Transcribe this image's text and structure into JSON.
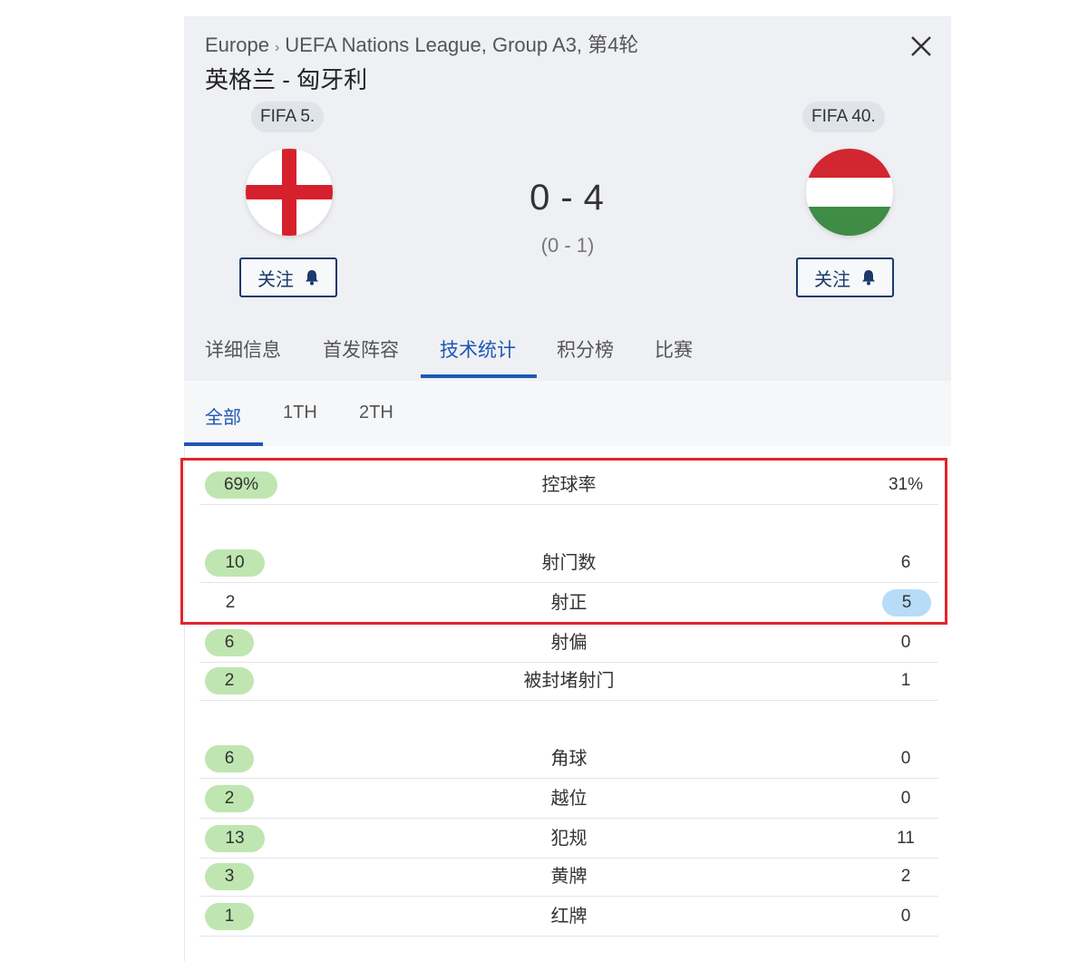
{
  "breadcrumb": {
    "region": "Europe",
    "competition": "UEFA Nations League, Group A3, 第4轮"
  },
  "match_title": "英格兰 - 匈牙利",
  "home": {
    "fifa_rank": "FIFA 5.",
    "follow_label": "关注",
    "flag": "england-flag-icon"
  },
  "away": {
    "fifa_rank": "FIFA 40.",
    "follow_label": "关注",
    "flag": "hungary-flag-icon"
  },
  "score": {
    "home": "0",
    "separator": "-",
    "away": "4",
    "halftime": "(0 - 1)"
  },
  "tabs": [
    {
      "label": "详细信息",
      "active": false
    },
    {
      "label": "首发阵容",
      "active": false
    },
    {
      "label": "技术统计",
      "active": true
    },
    {
      "label": "积分榜",
      "active": false
    },
    {
      "label": "比赛",
      "active": false
    }
  ],
  "subtabs": [
    {
      "label": "全部",
      "active": true
    },
    {
      "label": "1TH",
      "active": false
    },
    {
      "label": "2TH",
      "active": false
    }
  ],
  "stats": [
    {
      "label": "控球率",
      "home": "69%",
      "away": "31%",
      "leader": "home"
    },
    {
      "label": "射门数",
      "home": "10",
      "away": "6",
      "leader": "home"
    },
    {
      "label": "射正",
      "home": "2",
      "away": "5",
      "leader": "away"
    },
    {
      "label": "射偏",
      "home": "6",
      "away": "0",
      "leader": "home"
    },
    {
      "label": "被封堵射门",
      "home": "2",
      "away": "1",
      "leader": "home"
    },
    {
      "label": "角球",
      "home": "6",
      "away": "0",
      "leader": "home"
    },
    {
      "label": "越位",
      "home": "2",
      "away": "0",
      "leader": "home"
    },
    {
      "label": "犯规",
      "home": "13",
      "away": "11",
      "leader": "home"
    },
    {
      "label": "黄牌",
      "home": "3",
      "away": "2",
      "leader": "home"
    },
    {
      "label": "红牌",
      "home": "1",
      "away": "0",
      "leader": "home"
    }
  ],
  "colors": {
    "accent": "#1f57b5",
    "home_pill": "#bfe6b0",
    "away_pill": "#b7dcf7",
    "highlight_box": "#e1262b"
  }
}
